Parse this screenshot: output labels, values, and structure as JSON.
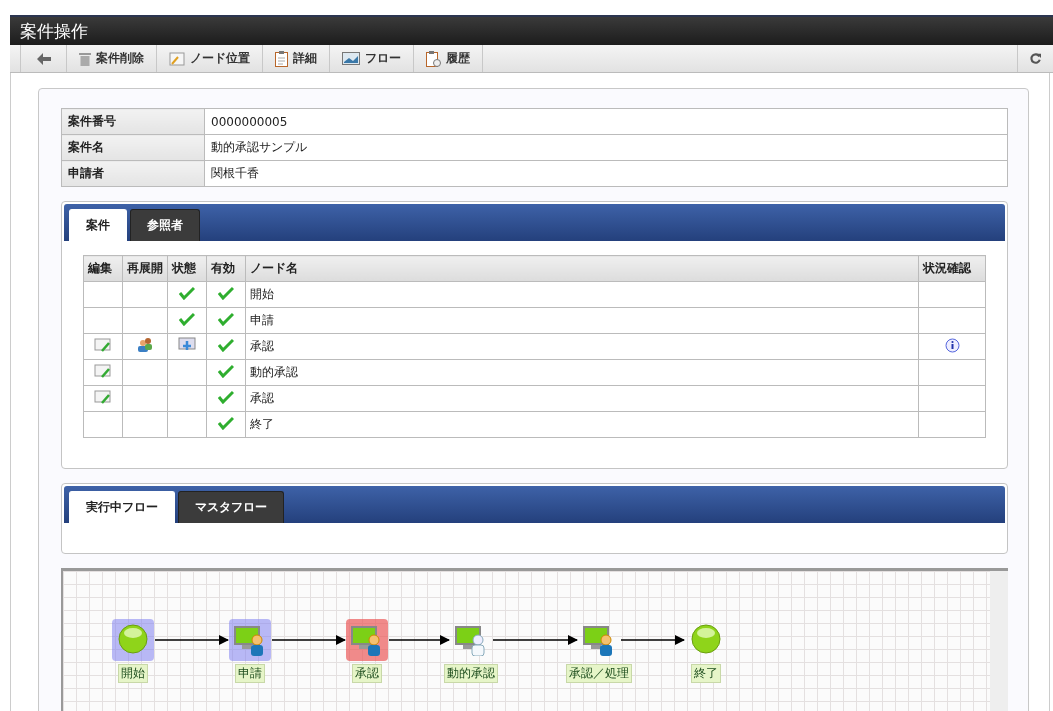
{
  "window": {
    "title": "案件操作"
  },
  "toolbar": {
    "buttons": [
      {
        "kind": "back"
      },
      {
        "kind": "trash",
        "label": "案件削除"
      },
      {
        "kind": "node",
        "label": "ノード位置"
      },
      {
        "kind": "detail",
        "label": "詳細"
      },
      {
        "kind": "flow",
        "label": "フロー"
      },
      {
        "kind": "history",
        "label": "履歴"
      }
    ],
    "refresh": {
      "kind": "refresh"
    }
  },
  "case_info": [
    {
      "label": "案件番号",
      "value": "0000000005"
    },
    {
      "label": "案件名",
      "value": "動的承認サンプル"
    },
    {
      "label": "申請者",
      "value": "関根千香"
    }
  ],
  "node_panel": {
    "tabs": [
      {
        "label": "案件",
        "selected": true
      },
      {
        "label": "参照者",
        "selected": false
      }
    ],
    "columns": [
      "編集",
      "再展開",
      "状態",
      "有効",
      "ノード名",
      "状況確認"
    ],
    "rows": [
      {
        "editable": false,
        "redeploy": false,
        "done": true,
        "active": false,
        "enabled": true,
        "name": "開始",
        "info": false
      },
      {
        "editable": false,
        "redeploy": false,
        "done": true,
        "active": false,
        "enabled": true,
        "name": "申請",
        "info": false
      },
      {
        "editable": true,
        "redeploy": true,
        "done": false,
        "active": true,
        "enabled": true,
        "name": "承認",
        "info": true
      },
      {
        "editable": true,
        "redeploy": false,
        "done": false,
        "active": false,
        "enabled": true,
        "name": "動的承認",
        "info": false
      },
      {
        "editable": true,
        "redeploy": false,
        "done": false,
        "active": false,
        "enabled": true,
        "name": "承認",
        "info": false
      },
      {
        "editable": false,
        "redeploy": false,
        "done": false,
        "active": false,
        "enabled": true,
        "name": "終了",
        "info": false
      }
    ]
  },
  "flow_panel": {
    "tabs": [
      {
        "label": "実行中フロー",
        "selected": true
      },
      {
        "label": "マスタフロー",
        "selected": false
      }
    ]
  },
  "flow": {
    "nodes": [
      {
        "kind": "start",
        "label": "開始",
        "visited": true,
        "current": false
      },
      {
        "kind": "user",
        "label": "申請",
        "visited": true,
        "current": false
      },
      {
        "kind": "user",
        "label": "承認",
        "visited": false,
        "current": true
      },
      {
        "kind": "dynamic",
        "label": "動的承認",
        "visited": false,
        "current": false
      },
      {
        "kind": "user",
        "label": "承認／処理",
        "visited": false,
        "current": false
      },
      {
        "kind": "end",
        "label": "終了",
        "visited": false,
        "current": false
      }
    ]
  }
}
